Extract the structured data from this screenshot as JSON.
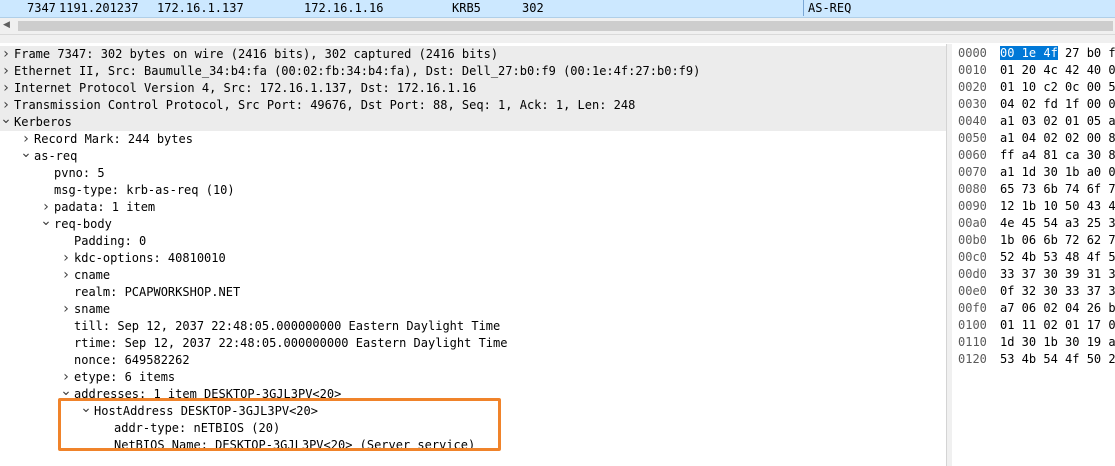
{
  "packet_list": {
    "selected_row": {
      "no": "7347",
      "time": "1191.201237",
      "source": "172.16.1.137",
      "destination": "172.16.1.16",
      "protocol": "KRB5",
      "length": "302",
      "info": "AS-REQ"
    }
  },
  "details": {
    "rows": [
      {
        "text": "Frame 7347: 302 bytes on wire (2416 bits), 302 captured (2416 bits)",
        "toggle": ">"
      },
      {
        "text": "Ethernet II, Src: Baumulle_34:b4:fa (00:02:fb:34:b4:fa), Dst: Dell_27:b0:f9 (00:1e:4f:27:b0:f9)",
        "toggle": ">"
      },
      {
        "text": "Internet Protocol Version 4, Src: 172.16.1.137, Dst: 172.16.1.16",
        "toggle": ">"
      },
      {
        "text": "Transmission Control Protocol, Src Port: 49676, Dst Port: 88, Seq: 1, Ack: 1, Len: 248",
        "toggle": ">"
      },
      {
        "text": "Kerberos",
        "toggle": "v"
      },
      {
        "text": "Record Mark: 244 bytes",
        "toggle": ">"
      },
      {
        "text": "as-req",
        "toggle": "v"
      },
      {
        "text": "pvno: 5",
        "toggle": ""
      },
      {
        "text": "msg-type: krb-as-req (10)",
        "toggle": ""
      },
      {
        "text": "padata: 1 item",
        "toggle": ">"
      },
      {
        "text": "req-body",
        "toggle": "v"
      },
      {
        "text": "Padding: 0",
        "toggle": ""
      },
      {
        "text": "kdc-options: 40810010",
        "toggle": ">"
      },
      {
        "text": "cname",
        "toggle": ">"
      },
      {
        "text": "realm: PCAPWORKSHOP.NET",
        "toggle": ""
      },
      {
        "text": "sname",
        "toggle": ">"
      },
      {
        "text": "till: Sep 12, 2037 22:48:05.000000000 Eastern Daylight Time",
        "toggle": ""
      },
      {
        "text": "rtime: Sep 12, 2037 22:48:05.000000000 Eastern Daylight Time",
        "toggle": ""
      },
      {
        "text": "nonce: 649582262",
        "toggle": ""
      },
      {
        "text": "etype: 6 items",
        "toggle": ">"
      },
      {
        "text": "addresses: 1 item DESKTOP-3GJL3PV<20>",
        "toggle": "v"
      },
      {
        "text": "HostAddress DESKTOP-3GJL3PV<20>",
        "toggle": "v"
      },
      {
        "text": "addr-type: nETBIOS (20)",
        "toggle": ""
      },
      {
        "text": "NetBIOS Name: DESKTOP-3GJL3PV<20> (Server service)",
        "toggle": ""
      }
    ]
  },
  "bytes": {
    "rows": [
      {
        "offset": "0000",
        "sel": "00 1e 4f",
        "hex": " 27 b0 f9"
      },
      {
        "offset": "0010",
        "sel": "",
        "hex": "01 20 4c 42 40 00"
      },
      {
        "offset": "0020",
        "sel": "",
        "hex": "01 10 c2 0c 00 58"
      },
      {
        "offset": "0030",
        "sel": "",
        "hex": "04 02 fd 1f 00 00"
      },
      {
        "offset": "0040",
        "sel": "",
        "hex": "a1 03 02 01 05 a2"
      },
      {
        "offset": "0050",
        "sel": "",
        "hex": "a1 04 02 02 00 80"
      },
      {
        "offset": "0060",
        "sel": "",
        "hex": "ff a4 81 ca 30 81"
      },
      {
        "offset": "0070",
        "sel": "",
        "hex": "a1 1d 30 1b a0 03"
      },
      {
        "offset": "0080",
        "sel": "",
        "hex": "65 73 6b 74 6f 70"
      },
      {
        "offset": "0090",
        "sel": "",
        "hex": "12 1b 10 50 43 41"
      },
      {
        "offset": "00a0",
        "sel": "",
        "hex": "4e 45 54 a3 25 30"
      },
      {
        "offset": "00b0",
        "sel": "",
        "hex": "1b 06 6b 72 62 74"
      },
      {
        "offset": "00c0",
        "sel": "",
        "hex": "52 4b 53 48 4f 50"
      },
      {
        "offset": "00d0",
        "sel": "",
        "hex": "33 37 30 39 31 32"
      },
      {
        "offset": "00e0",
        "sel": "",
        "hex": "0f 32 30 33 37 30"
      },
      {
        "offset": "00f0",
        "sel": "",
        "hex": "a7 06 02 04 26 b"
      },
      {
        "offset": "0100",
        "sel": "",
        "hex": "01 11 02 01 17 02"
      },
      {
        "offset": "0110",
        "sel": "",
        "hex": "1d 30 1b 30 19 a0"
      },
      {
        "offset": "0120",
        "sel": "",
        "hex": "53 4b 54 4f 50 2d"
      }
    ]
  },
  "icons": {
    "expand": "chevron-right-icon",
    "collapse": "chevron-down-icon"
  },
  "colors": {
    "selected_row": "#cce8ff",
    "annotation_box": "#f0832a",
    "byte_selection": "#0078d7"
  }
}
